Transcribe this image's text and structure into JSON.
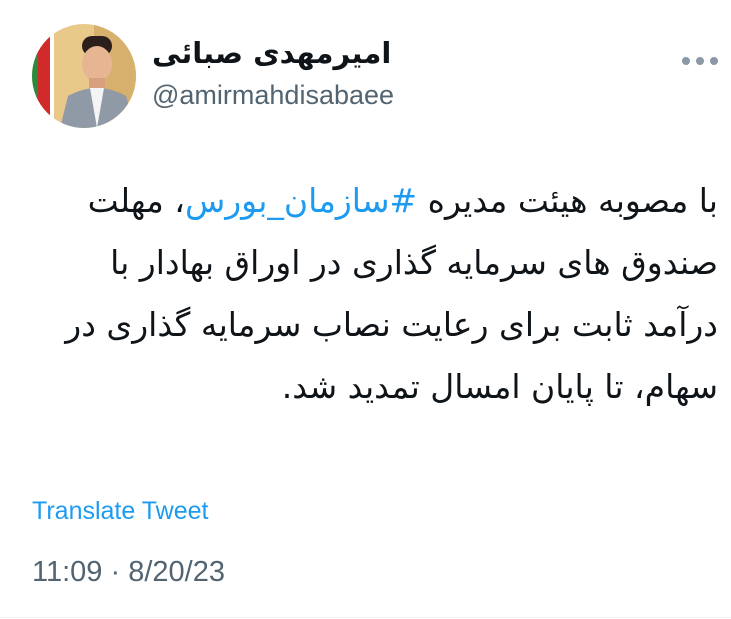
{
  "author": {
    "display_name": "امیرمهدی صبائی",
    "handle": "@amirmahdisabaee"
  },
  "tweet": {
    "text_before": "با مصوبه هیئت مدیره ",
    "hashtag": "#سازمان_بورس",
    "text_after": "، مهلت صندوق های سرمایه گذاری در اوراق بهادار با درآمد ثابت برای رعایت نصاب سرمایه گذاری در سهام، تا پایان امسال تمدید شد.",
    "translate_label": "Translate Tweet",
    "time": "11:09",
    "separator": "·",
    "date": "8/20/23"
  },
  "icons": {
    "more": "more-horizontal-icon"
  },
  "colors": {
    "accent": "#1d9bf0",
    "secondary_text": "#536471",
    "primary_text": "#0f1419"
  }
}
